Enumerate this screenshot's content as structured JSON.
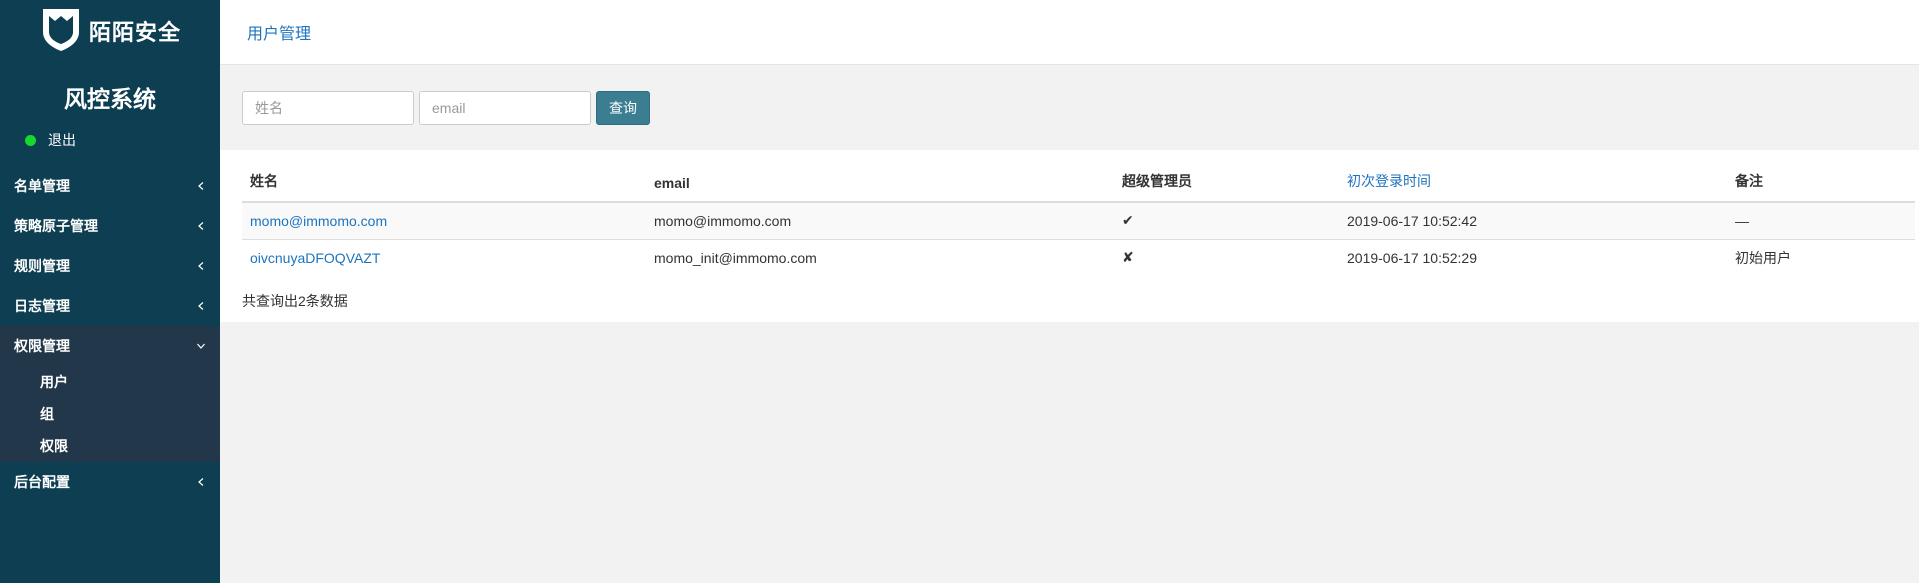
{
  "brand": {
    "name": "陌陌安全",
    "logo_icon": "shield-icon"
  },
  "system_title": "风控系统",
  "user": {
    "status_color": "#16d92d",
    "logout_label": "退出"
  },
  "sidebar": {
    "items": [
      {
        "label": "名单管理",
        "expanded": false
      },
      {
        "label": "策略原子管理",
        "expanded": false
      },
      {
        "label": "规则管理",
        "expanded": false
      },
      {
        "label": "日志管理",
        "expanded": false
      },
      {
        "label": "权限管理",
        "expanded": true,
        "children": [
          {
            "label": "用户"
          },
          {
            "label": "组"
          },
          {
            "label": "权限"
          }
        ]
      },
      {
        "label": "后台配置",
        "expanded": false
      }
    ]
  },
  "header": {
    "title": "用户管理"
  },
  "filters": {
    "name_placeholder": "姓名",
    "email_placeholder": "email",
    "query_label": "查询"
  },
  "table": {
    "columns": [
      "姓名",
      "email",
      "超级管理员",
      "初次登录时间",
      "备注"
    ],
    "rows": [
      {
        "name": "momo@immomo.com",
        "email": "momo@immomo.com",
        "is_superuser": "✔",
        "first_login": "2019-06-17 10:52:42",
        "note": "—"
      },
      {
        "name": "oivcnuyaDFOQVAZT",
        "email": "momo_init@immomo.com",
        "is_superuser": "✘",
        "first_login": "2019-06-17 10:52:29",
        "note": "初始用户"
      }
    ]
  },
  "summary": "共查询出2条数据",
  "colors": {
    "sidebar_bg": "#0d3e52",
    "submenu_bg": "#22384a",
    "link": "#1e73be",
    "button": "#3b7d91"
  }
}
